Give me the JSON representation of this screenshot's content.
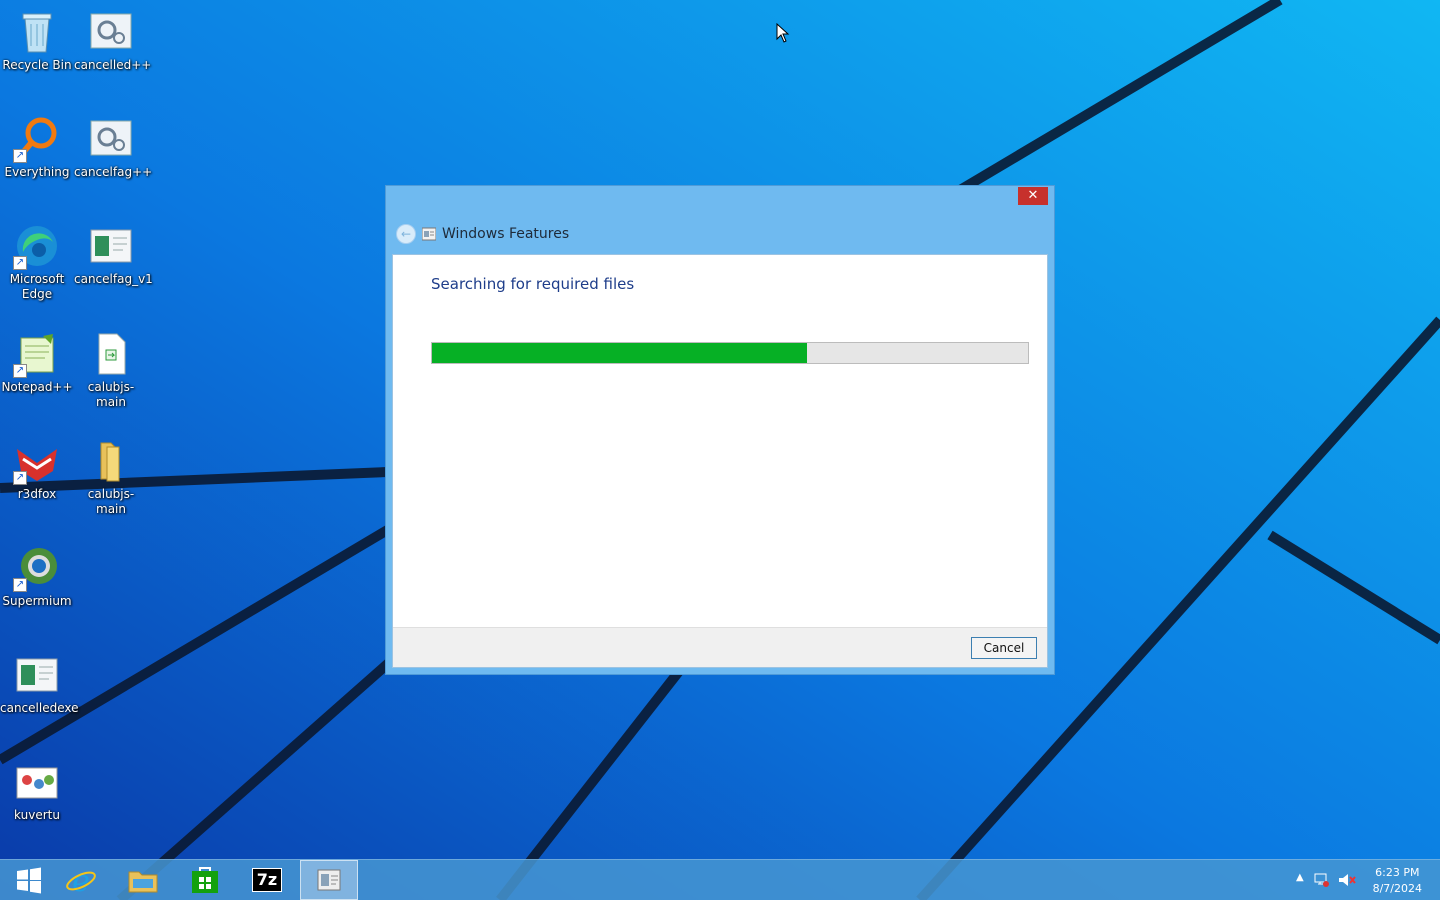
{
  "desktop": {
    "icons": [
      {
        "label": "Recycle Bin",
        "icon": "recycle-bin-icon",
        "shortcut": false
      },
      {
        "label": "cancelled++",
        "icon": "gear-document-icon",
        "shortcut": false
      },
      {
        "label": "Everything",
        "icon": "everything-search-icon",
        "shortcut": true
      },
      {
        "label": "cancelfag++",
        "icon": "gear-document-icon",
        "shortcut": false
      },
      {
        "label": "Microsoft Edge",
        "icon": "edge-icon",
        "shortcut": true
      },
      {
        "label": "cancelfag_v1",
        "icon": "window-document-icon",
        "shortcut": false
      },
      {
        "label": "Notepad++",
        "icon": "notepad-plus-plus-icon",
        "shortcut": true
      },
      {
        "label": "calubjs-main",
        "icon": "file-shortcut-icon",
        "shortcut": false
      },
      {
        "label": "r3dfox",
        "icon": "r3dfox-icon",
        "shortcut": true
      },
      {
        "label": "calubjs-main",
        "icon": "folder-icon",
        "shortcut": false
      },
      {
        "label": "Supermium",
        "icon": "supermium-icon",
        "shortcut": true
      },
      {
        "label": "cancelledexe",
        "icon": "window-document-icon",
        "shortcut": false
      },
      {
        "label": "kuvertu",
        "icon": "image-icon",
        "shortcut": false
      }
    ]
  },
  "dialog": {
    "title": "Windows Features",
    "close_label": "✕",
    "status": "Searching for required files",
    "progress": 0.63,
    "cancel_label": "Cancel"
  },
  "taskbar": {
    "items": [
      "start-icon",
      "internet-explorer-icon",
      "file-explorer-icon",
      "store-icon",
      "7zip-icon",
      "windows-features-icon"
    ],
    "seven_zip_label": "7z",
    "clock": {
      "time": "6:23 PM",
      "date": "8/7/2024"
    }
  },
  "colors": {
    "accent": "#06b025",
    "title_bar": "#6fbaf0",
    "close_button": "#c7312c"
  }
}
